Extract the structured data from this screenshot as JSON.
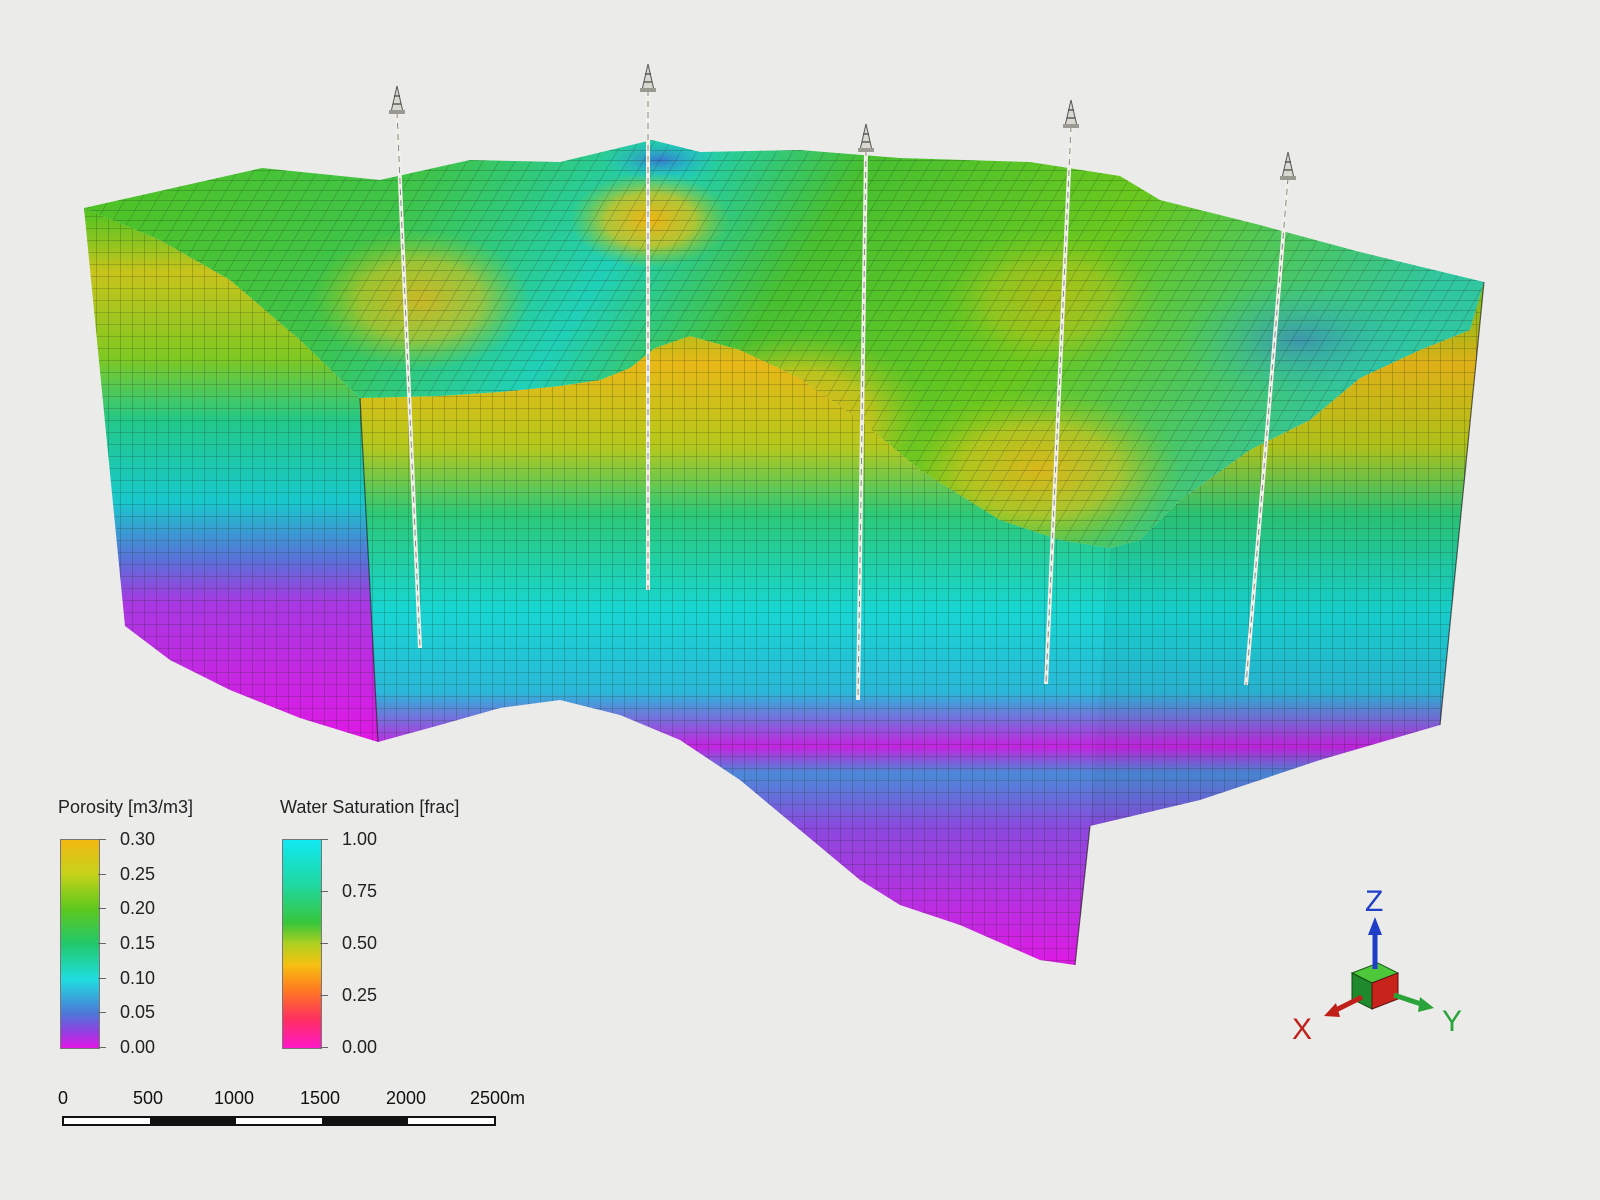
{
  "legends": {
    "porosity": {
      "title": "Porosity [m3/m3]",
      "labels": [
        "0.30",
        "0.25",
        "0.20",
        "0.15",
        "0.10",
        "0.05",
        "0.00"
      ]
    },
    "water_saturation": {
      "title": "Water Saturation [frac]",
      "labels": [
        "1.00",
        "0.75",
        "0.50",
        "0.25",
        "0.00"
      ]
    }
  },
  "scale_bar": {
    "labels": [
      "0",
      "500",
      "1000",
      "1500",
      "2000",
      "2500m"
    ]
  },
  "axes": {
    "x_label": "X",
    "y_label": "Y",
    "z_label": "Z",
    "x_color": "#c0201a",
    "y_color": "#2aa43a",
    "z_color": "#1f3ec8"
  },
  "colors": {
    "background": "#ebebea",
    "porosity_high": "#f2b812",
    "porosity_low": "#e218e6",
    "saturation_high": "#10e8f2",
    "saturation_low": "#ff18c8"
  },
  "wells": [
    {
      "id": "well-1",
      "icon": "derrick-icon"
    },
    {
      "id": "well-2",
      "icon": "derrick-icon"
    },
    {
      "id": "well-3",
      "icon": "derrick-icon"
    },
    {
      "id": "well-4",
      "icon": "derrick-icon"
    },
    {
      "id": "well-5",
      "icon": "derrick-icon"
    }
  ]
}
